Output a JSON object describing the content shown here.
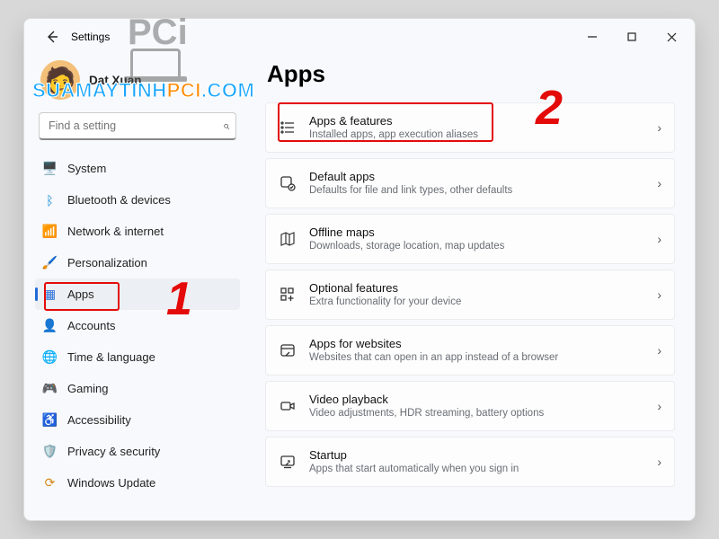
{
  "title": "Settings",
  "user": {
    "name": "Dat Xuan"
  },
  "search": {
    "placeholder": "Find a setting"
  },
  "sidebar": {
    "items": [
      {
        "label": "System"
      },
      {
        "label": "Bluetooth & devices"
      },
      {
        "label": "Network & internet"
      },
      {
        "label": "Personalization"
      },
      {
        "label": "Apps"
      },
      {
        "label": "Accounts"
      },
      {
        "label": "Time & language"
      },
      {
        "label": "Gaming"
      },
      {
        "label": "Accessibility"
      },
      {
        "label": "Privacy & security"
      },
      {
        "label": "Windows Update"
      }
    ]
  },
  "page": {
    "heading": "Apps"
  },
  "cards": [
    {
      "title": "Apps & features",
      "sub": "Installed apps, app execution aliases"
    },
    {
      "title": "Default apps",
      "sub": "Defaults for file and link types, other defaults"
    },
    {
      "title": "Offline maps",
      "sub": "Downloads, storage location, map updates"
    },
    {
      "title": "Optional features",
      "sub": "Extra functionality for your device"
    },
    {
      "title": "Apps for websites",
      "sub": "Websites that can open in an app instead of a browser"
    },
    {
      "title": "Video playback",
      "sub": "Video adjustments, HDR streaming, battery options"
    },
    {
      "title": "Startup",
      "sub": "Apps that start automatically when you sign in"
    }
  ],
  "annotations": {
    "num1": "1",
    "num2": "2"
  },
  "watermark": {
    "text_a": "SUAMAYTINH",
    "text_b": "PCI",
    "text_c": ".COM",
    "logo": "PCi"
  }
}
